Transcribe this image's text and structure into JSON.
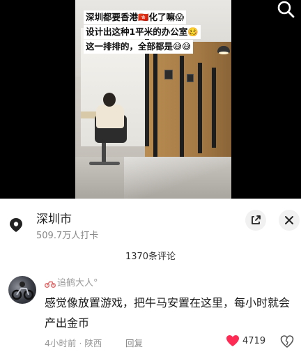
{
  "video": {
    "caption_lines": [
      "深圳都要香港🇭🇰化了嘛😱",
      "设计出这种1平米的办公室🥴",
      "这一排排的，全部都是😅😅"
    ],
    "search_icon": "search-icon"
  },
  "location": {
    "name": "深圳市",
    "checkins": "509.7万人打卡",
    "pin_icon": "location-pin-icon",
    "share_icon": "share-icon",
    "close_icon": "close-icon"
  },
  "comments": {
    "count_label": "1370条评论"
  },
  "comment": {
    "username": "追鹤大人°",
    "text": "感觉像放置游戏，把牛马安置在这里，每小时就会产出金币",
    "time": "4小时前",
    "region": "陕西",
    "separator": "·",
    "reply_label": "回复",
    "like_count": "4719",
    "like_color": "#fe2c55",
    "like_icon": "heart-icon",
    "dislike_icon": "broken-heart-icon"
  }
}
